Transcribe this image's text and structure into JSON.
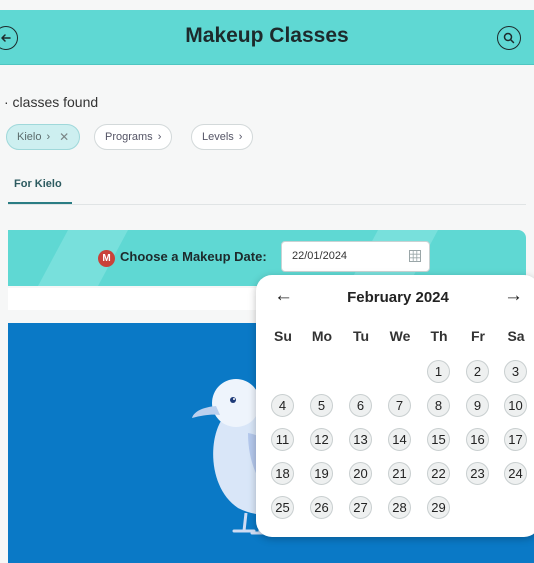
{
  "header": {
    "title": "Makeup Classes"
  },
  "results": {
    "found_text": "· classes found"
  },
  "filters": [
    {
      "label": "Kielo",
      "active": true
    },
    {
      "label": "Programs",
      "active": false
    },
    {
      "label": "Levels",
      "active": false
    }
  ],
  "tabs": [
    {
      "label": "For Kielo",
      "selected": true
    }
  ],
  "date_picker": {
    "badge": "M",
    "label": "Choose a Makeup Date:",
    "value": "22/01/2024"
  },
  "calendar": {
    "month_label": "February 2024",
    "weekdays": [
      "Su",
      "Mo",
      "Tu",
      "We",
      "Th",
      "Fr",
      "Sa"
    ],
    "first_weekday_index": 4,
    "days": [
      1,
      2,
      3,
      4,
      5,
      6,
      7,
      8,
      9,
      10,
      11,
      12,
      13,
      14,
      15,
      16,
      17,
      18,
      19,
      20,
      21,
      22,
      23,
      24,
      25,
      26,
      27,
      28,
      29
    ]
  },
  "icons": {
    "back": "arrow-left-icon",
    "search": "search-icon",
    "calendar": "calendar-grid-icon",
    "prev": "arrow-left-icon",
    "next": "arrow-right-icon"
  },
  "colors": {
    "header": "#5fd8d3",
    "hero": "#0a79c6",
    "badge": "#c9423a"
  }
}
